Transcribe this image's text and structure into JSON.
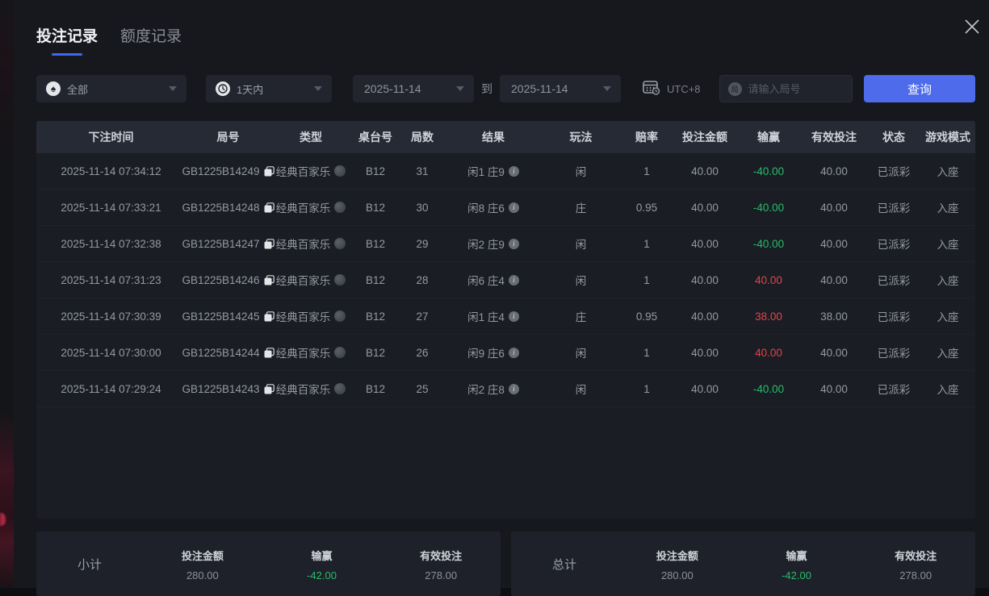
{
  "tabs": [
    {
      "label": "投注记录",
      "active": true
    },
    {
      "label": "额度记录",
      "active": false
    }
  ],
  "filters": {
    "game_type_value": "全部",
    "time_range_value": "1天内",
    "date_from": "2025-11-14",
    "to_label": "到",
    "date_to": "2025-11-14",
    "timezone": "UTC+8",
    "round_input_placeholder": "请输入局号",
    "search_label": "查询"
  },
  "table": {
    "headers": [
      "下注时间",
      "局号",
      "类型",
      "桌台号",
      "局数",
      "结果",
      "玩法",
      "赔率",
      "投注金额",
      "输赢",
      "有效投注",
      "状态",
      "游戏模式"
    ],
    "rows": [
      {
        "time": "2025-11-14 07:34:12",
        "round_id": "GB1225B14249",
        "type": "经典百家乐",
        "table_no": "B12",
        "round": "31",
        "result": "闲1 庄9",
        "play": "闲",
        "odds": "1",
        "bet": "40.00",
        "winloss": "-40.00",
        "valid": "40.00",
        "status": "已派彩",
        "mode": "入座"
      },
      {
        "time": "2025-11-14 07:33:21",
        "round_id": "GB1225B14248",
        "type": "经典百家乐",
        "table_no": "B12",
        "round": "30",
        "result": "闲8 庄6",
        "play": "庄",
        "odds": "0.95",
        "bet": "40.00",
        "winloss": "-40.00",
        "valid": "40.00",
        "status": "已派彩",
        "mode": "入座"
      },
      {
        "time": "2025-11-14 07:32:38",
        "round_id": "GB1225B14247",
        "type": "经典百家乐",
        "table_no": "B12",
        "round": "29",
        "result": "闲2 庄9",
        "play": "闲",
        "odds": "1",
        "bet": "40.00",
        "winloss": "-40.00",
        "valid": "40.00",
        "status": "已派彩",
        "mode": "入座"
      },
      {
        "time": "2025-11-14 07:31:23",
        "round_id": "GB1225B14246",
        "type": "经典百家乐",
        "table_no": "B12",
        "round": "28",
        "result": "闲6 庄4",
        "play": "闲",
        "odds": "1",
        "bet": "40.00",
        "winloss": "40.00",
        "valid": "40.00",
        "status": "已派彩",
        "mode": "入座"
      },
      {
        "time": "2025-11-14 07:30:39",
        "round_id": "GB1225B14245",
        "type": "经典百家乐",
        "table_no": "B12",
        "round": "27",
        "result": "闲1 庄4",
        "play": "庄",
        "odds": "0.95",
        "bet": "40.00",
        "winloss": "38.00",
        "valid": "38.00",
        "status": "已派彩",
        "mode": "入座"
      },
      {
        "time": "2025-11-14 07:30:00",
        "round_id": "GB1225B14244",
        "type": "经典百家乐",
        "table_no": "B12",
        "round": "26",
        "result": "闲9 庄6",
        "play": "闲",
        "odds": "1",
        "bet": "40.00",
        "winloss": "40.00",
        "valid": "40.00",
        "status": "已派彩",
        "mode": "入座"
      },
      {
        "time": "2025-11-14 07:29:24",
        "round_id": "GB1225B14243",
        "type": "经典百家乐",
        "table_no": "B12",
        "round": "25",
        "result": "闲2 庄8",
        "play": "闲",
        "odds": "1",
        "bet": "40.00",
        "winloss": "-40.00",
        "valid": "40.00",
        "status": "已派彩",
        "mode": "入座"
      }
    ]
  },
  "summary": {
    "subtotal": {
      "label": "小计",
      "bet_title": "投注金额",
      "bet": "280.00",
      "winloss_title": "输赢",
      "winloss": "-42.00",
      "valid_title": "有效投注",
      "valid": "278.00"
    },
    "total": {
      "label": "总计",
      "bet_title": "投注金额",
      "bet": "280.00",
      "winloss_title": "输赢",
      "winloss": "-42.00",
      "valid_title": "有效投注",
      "valid": "278.00"
    }
  },
  "colors": {
    "accent_blue": "#4d6bea",
    "win_red": "#e14646",
    "loss_green": "#27bd68"
  }
}
